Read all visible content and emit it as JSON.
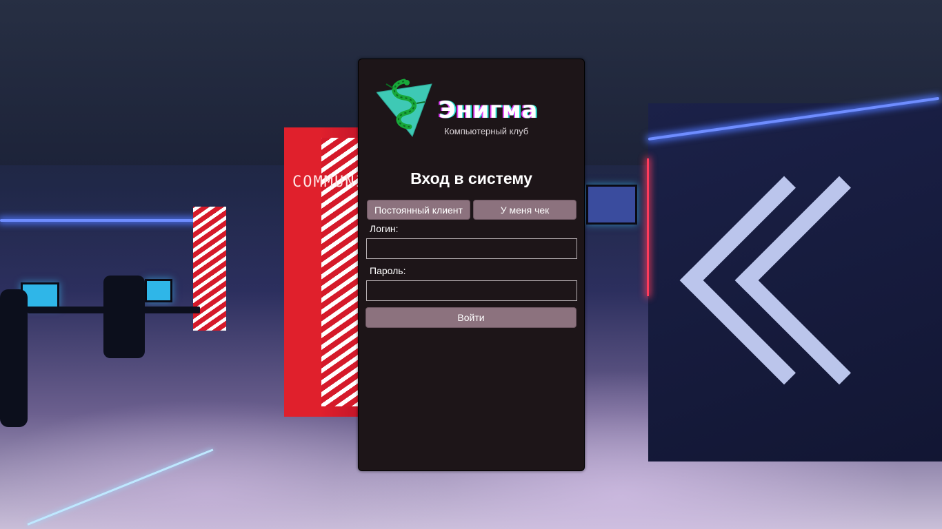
{
  "brand": {
    "title": "Энигма",
    "subtitle": "Компьютерный клуб",
    "logo_icon": "dragon-triangle-logo"
  },
  "background": {
    "column_sign": "COMMUNITY"
  },
  "login": {
    "heading": "Вход в систему",
    "tabs": [
      {
        "label": "Постоянный клиент"
      },
      {
        "label": "У меня чек"
      }
    ],
    "login_label": "Логин:",
    "login_value": "",
    "password_label": "Пароль:",
    "password_value": "",
    "submit_label": "Войти"
  },
  "colors": {
    "panel_bg": "#1d1518",
    "button_bg": "#8c727e",
    "logo_teal": "#3ec9b5",
    "logo_green": "#18a83a"
  }
}
